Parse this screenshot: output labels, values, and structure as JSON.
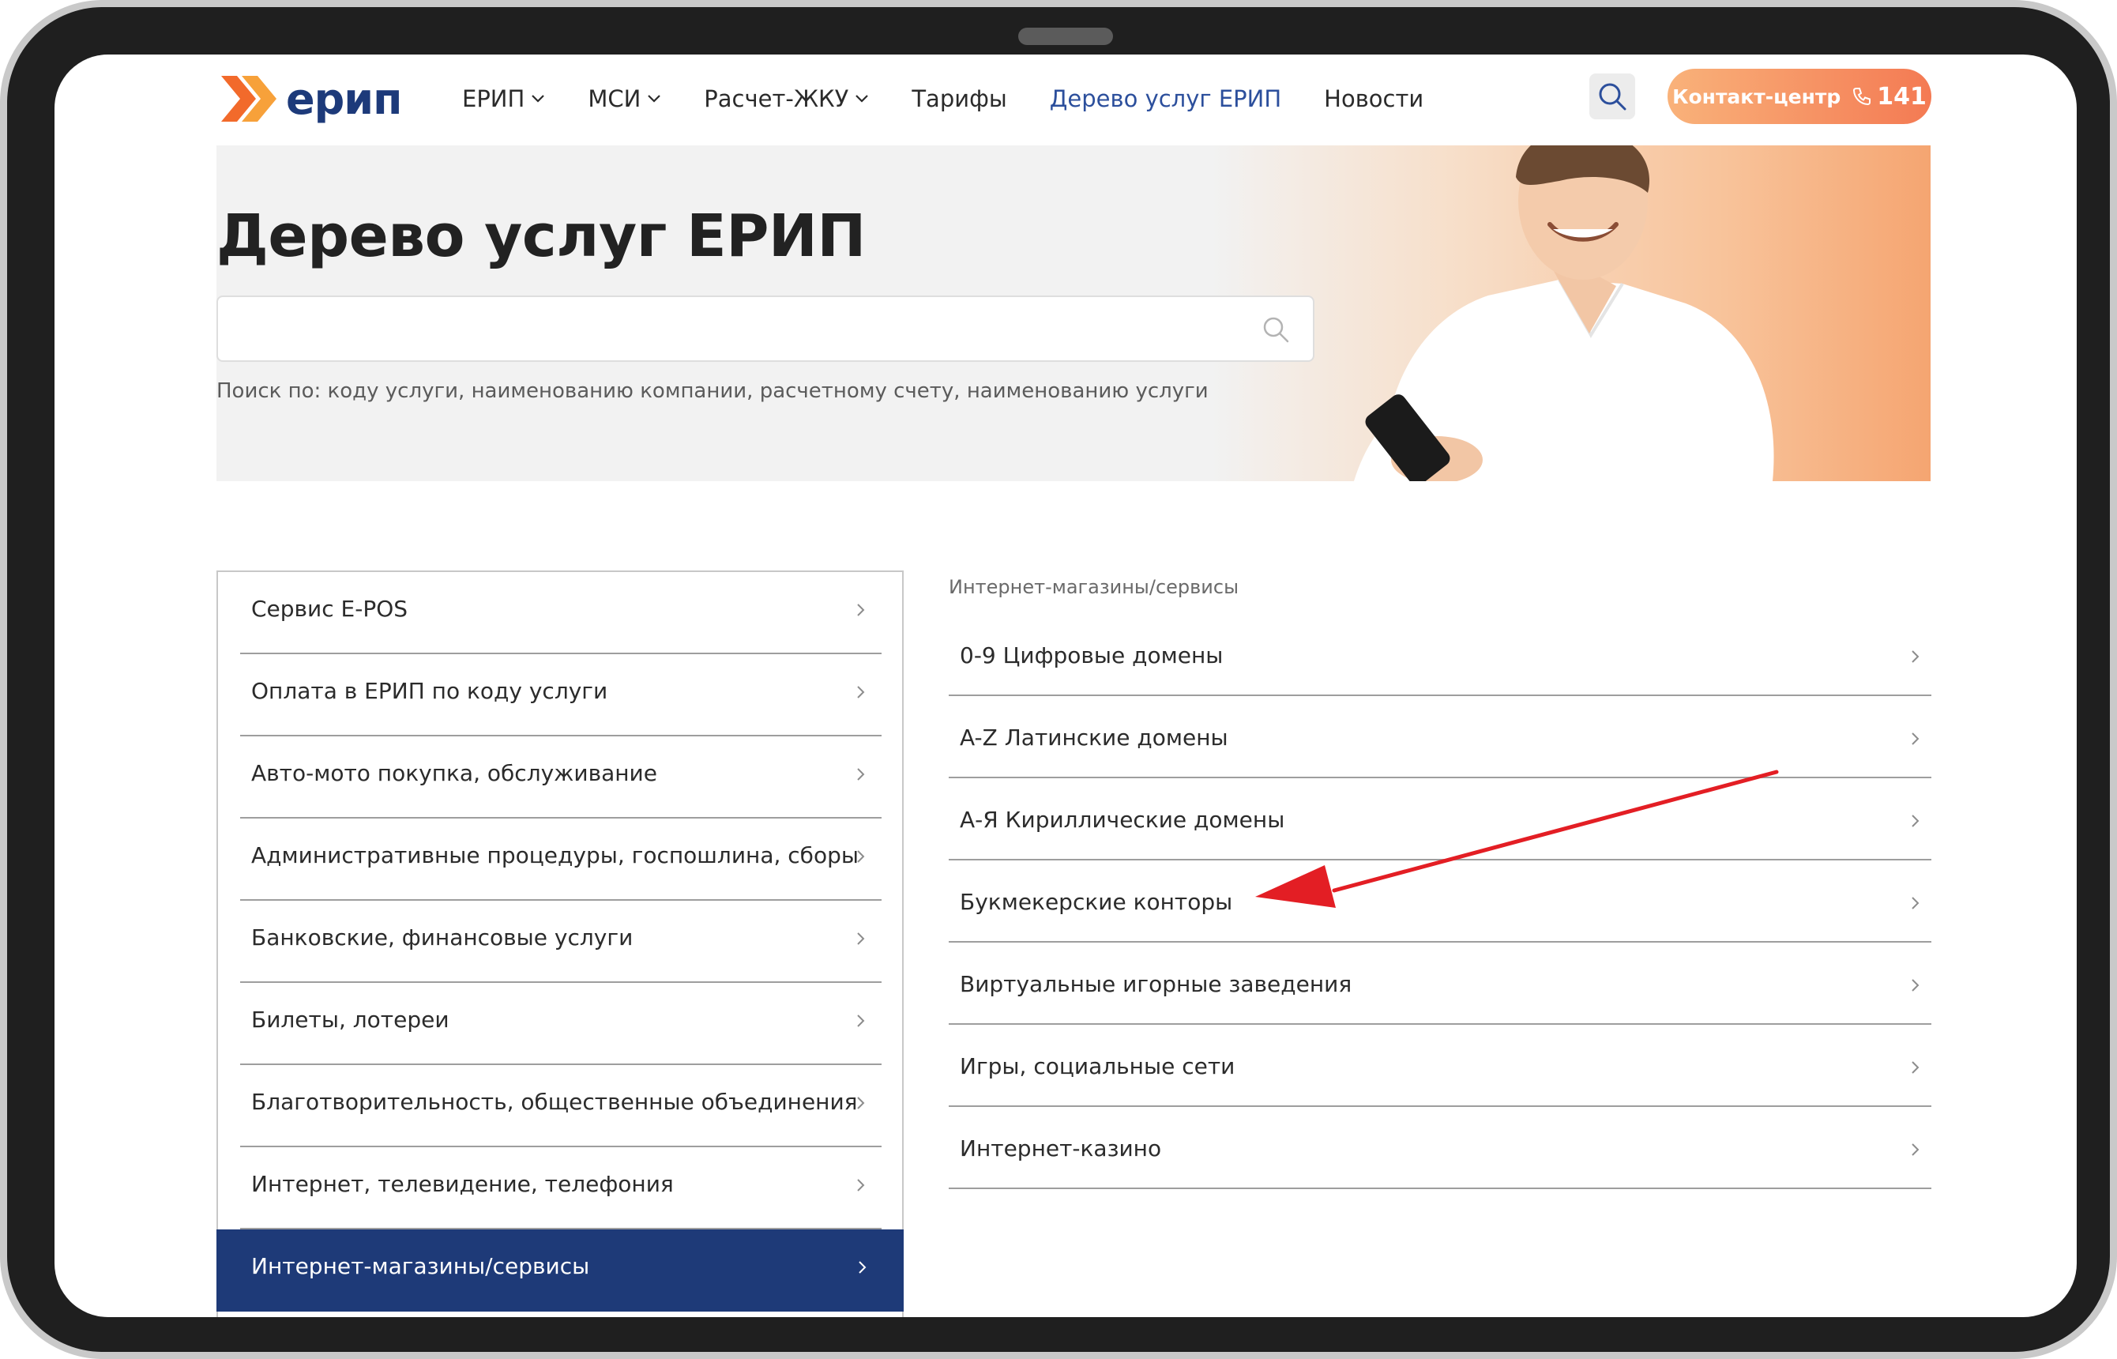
{
  "header": {
    "logo_text": "ерип",
    "nav": [
      {
        "label": "ЕРИП",
        "dropdown": true
      },
      {
        "label": "МСИ",
        "dropdown": true
      },
      {
        "label": "Расчет-ЖКУ",
        "dropdown": true
      },
      {
        "label": "Тарифы",
        "dropdown": false
      },
      {
        "label": "Дерево услуг ЕРИП",
        "dropdown": false,
        "active": true
      },
      {
        "label": "Новости",
        "dropdown": false
      }
    ],
    "search_icon": "search-icon",
    "contact": {
      "label": "Контакт-центр",
      "phone_icon": "phone-icon",
      "number": "141"
    }
  },
  "hero": {
    "title": "Дерево услуг ЕРИП",
    "search_value": "",
    "search_hint": "Поиск по: коду услуги, наименованию компании, расчетному счету, наименованию услуги"
  },
  "left_menu": {
    "items": [
      {
        "label": "Сервис E-POS"
      },
      {
        "label": "Оплата в ЕРИП по коду услуги"
      },
      {
        "label": "Авто-мото покупка, обслуживание"
      },
      {
        "label": "Административные процедуры, госпошлина, сборы"
      },
      {
        "label": "Банковские, финансовые услуги"
      },
      {
        "label": "Билеты, лотереи"
      },
      {
        "label": "Благотворительность, общественные объединения"
      },
      {
        "label": "Интернет, телевидение, телефония"
      },
      {
        "label": "Интернет-магазины/сервисы",
        "active": true
      }
    ]
  },
  "right_panel": {
    "breadcrumb": "Интернет-магазины/сервисы",
    "items": [
      {
        "label": "0-9 Цифровые домены"
      },
      {
        "label": "A-Z Латинские домены"
      },
      {
        "label": "А-Я Кириллические домены"
      },
      {
        "label": "Букмекерские конторы"
      },
      {
        "label": "Виртуальные игорные заведения"
      },
      {
        "label": "Игры, социальные сети"
      },
      {
        "label": "Интернет-казино"
      }
    ]
  },
  "colors": {
    "brand_blue": "#1e3a78",
    "nav_active": "#2c4f9c",
    "accent_orange": "#f47a53",
    "annotation_red": "#e31e24"
  }
}
